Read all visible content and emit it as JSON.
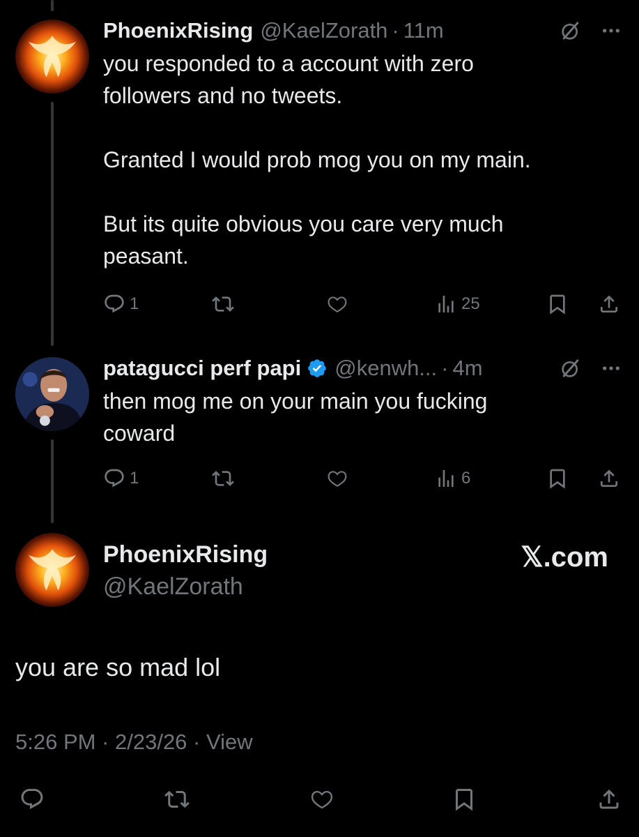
{
  "tweets": [
    {
      "name": "PhoenixRising",
      "handle": "@KaelZorath",
      "separator": "·",
      "time": "11m",
      "text": "you responded to a account with zero\nfollowers and no tweets.\n\nGranted I would prob mog you on my main.\n\nBut its quite obvious you care very much\npeasant.",
      "reply_count": "1",
      "views": "25",
      "avatar": "phoenix-avatar"
    },
    {
      "name": "patagucci perf papi",
      "handle": "@kenwh...",
      "separator": "·",
      "time": "4m",
      "verified": true,
      "text": "then mog me on your main you fucking\ncoward",
      "reply_count": "1",
      "views": "6",
      "avatar": "person-avatar"
    }
  ],
  "main": {
    "name": "PhoenixRising",
    "handle": "@KaelZorath",
    "brand": "𝕏.com",
    "text": "you are so mad lol",
    "timestamp": "5:26 PM · 2/23/26 · View"
  },
  "colors": {
    "background": "#000000",
    "text": "#e7e9ea",
    "muted": "#71767b",
    "verified": "#1d9bf0"
  },
  "icons": [
    "reply-icon",
    "retweet-icon",
    "like-icon",
    "views-icon",
    "bookmark-icon",
    "share-icon",
    "grok-icon",
    "more-icon",
    "verified-badge-icon"
  ]
}
